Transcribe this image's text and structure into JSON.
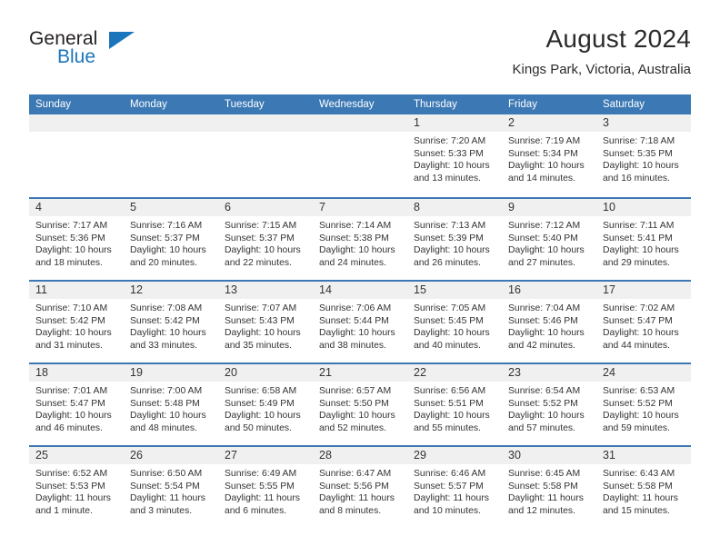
{
  "brand": {
    "name_top": "General",
    "name_bottom": "Blue",
    "triangle_color": "#1b75bb"
  },
  "header": {
    "title": "August 2024",
    "subtitle": "Kings Park, Victoria, Australia",
    "accent_color": "#3b78b4",
    "daynum_band_color": "#f0f0f0"
  },
  "weekdays": [
    "Sunday",
    "Monday",
    "Tuesday",
    "Wednesday",
    "Thursday",
    "Friday",
    "Saturday"
  ],
  "weeks": [
    [
      {
        "day": "",
        "empty": true,
        "sunrise": "",
        "sunset": "",
        "daylight1": "",
        "daylight2": ""
      },
      {
        "day": "",
        "empty": true,
        "sunrise": "",
        "sunset": "",
        "daylight1": "",
        "daylight2": ""
      },
      {
        "day": "",
        "empty": true,
        "sunrise": "",
        "sunset": "",
        "daylight1": "",
        "daylight2": ""
      },
      {
        "day": "",
        "empty": true,
        "sunrise": "",
        "sunset": "",
        "daylight1": "",
        "daylight2": ""
      },
      {
        "day": "1",
        "empty": false,
        "sunrise": "Sunrise: 7:20 AM",
        "sunset": "Sunset: 5:33 PM",
        "daylight1": "Daylight: 10 hours",
        "daylight2": "and 13 minutes."
      },
      {
        "day": "2",
        "empty": false,
        "sunrise": "Sunrise: 7:19 AM",
        "sunset": "Sunset: 5:34 PM",
        "daylight1": "Daylight: 10 hours",
        "daylight2": "and 14 minutes."
      },
      {
        "day": "3",
        "empty": false,
        "sunrise": "Sunrise: 7:18 AM",
        "sunset": "Sunset: 5:35 PM",
        "daylight1": "Daylight: 10 hours",
        "daylight2": "and 16 minutes."
      }
    ],
    [
      {
        "day": "4",
        "empty": false,
        "sunrise": "Sunrise: 7:17 AM",
        "sunset": "Sunset: 5:36 PM",
        "daylight1": "Daylight: 10 hours",
        "daylight2": "and 18 minutes."
      },
      {
        "day": "5",
        "empty": false,
        "sunrise": "Sunrise: 7:16 AM",
        "sunset": "Sunset: 5:37 PM",
        "daylight1": "Daylight: 10 hours",
        "daylight2": "and 20 minutes."
      },
      {
        "day": "6",
        "empty": false,
        "sunrise": "Sunrise: 7:15 AM",
        "sunset": "Sunset: 5:37 PM",
        "daylight1": "Daylight: 10 hours",
        "daylight2": "and 22 minutes."
      },
      {
        "day": "7",
        "empty": false,
        "sunrise": "Sunrise: 7:14 AM",
        "sunset": "Sunset: 5:38 PM",
        "daylight1": "Daylight: 10 hours",
        "daylight2": "and 24 minutes."
      },
      {
        "day": "8",
        "empty": false,
        "sunrise": "Sunrise: 7:13 AM",
        "sunset": "Sunset: 5:39 PM",
        "daylight1": "Daylight: 10 hours",
        "daylight2": "and 26 minutes."
      },
      {
        "day": "9",
        "empty": false,
        "sunrise": "Sunrise: 7:12 AM",
        "sunset": "Sunset: 5:40 PM",
        "daylight1": "Daylight: 10 hours",
        "daylight2": "and 27 minutes."
      },
      {
        "day": "10",
        "empty": false,
        "sunrise": "Sunrise: 7:11 AM",
        "sunset": "Sunset: 5:41 PM",
        "daylight1": "Daylight: 10 hours",
        "daylight2": "and 29 minutes."
      }
    ],
    [
      {
        "day": "11",
        "empty": false,
        "sunrise": "Sunrise: 7:10 AM",
        "sunset": "Sunset: 5:42 PM",
        "daylight1": "Daylight: 10 hours",
        "daylight2": "and 31 minutes."
      },
      {
        "day": "12",
        "empty": false,
        "sunrise": "Sunrise: 7:08 AM",
        "sunset": "Sunset: 5:42 PM",
        "daylight1": "Daylight: 10 hours",
        "daylight2": "and 33 minutes."
      },
      {
        "day": "13",
        "empty": false,
        "sunrise": "Sunrise: 7:07 AM",
        "sunset": "Sunset: 5:43 PM",
        "daylight1": "Daylight: 10 hours",
        "daylight2": "and 35 minutes."
      },
      {
        "day": "14",
        "empty": false,
        "sunrise": "Sunrise: 7:06 AM",
        "sunset": "Sunset: 5:44 PM",
        "daylight1": "Daylight: 10 hours",
        "daylight2": "and 38 minutes."
      },
      {
        "day": "15",
        "empty": false,
        "sunrise": "Sunrise: 7:05 AM",
        "sunset": "Sunset: 5:45 PM",
        "daylight1": "Daylight: 10 hours",
        "daylight2": "and 40 minutes."
      },
      {
        "day": "16",
        "empty": false,
        "sunrise": "Sunrise: 7:04 AM",
        "sunset": "Sunset: 5:46 PM",
        "daylight1": "Daylight: 10 hours",
        "daylight2": "and 42 minutes."
      },
      {
        "day": "17",
        "empty": false,
        "sunrise": "Sunrise: 7:02 AM",
        "sunset": "Sunset: 5:47 PM",
        "daylight1": "Daylight: 10 hours",
        "daylight2": "and 44 minutes."
      }
    ],
    [
      {
        "day": "18",
        "empty": false,
        "sunrise": "Sunrise: 7:01 AM",
        "sunset": "Sunset: 5:47 PM",
        "daylight1": "Daylight: 10 hours",
        "daylight2": "and 46 minutes."
      },
      {
        "day": "19",
        "empty": false,
        "sunrise": "Sunrise: 7:00 AM",
        "sunset": "Sunset: 5:48 PM",
        "daylight1": "Daylight: 10 hours",
        "daylight2": "and 48 minutes."
      },
      {
        "day": "20",
        "empty": false,
        "sunrise": "Sunrise: 6:58 AM",
        "sunset": "Sunset: 5:49 PM",
        "daylight1": "Daylight: 10 hours",
        "daylight2": "and 50 minutes."
      },
      {
        "day": "21",
        "empty": false,
        "sunrise": "Sunrise: 6:57 AM",
        "sunset": "Sunset: 5:50 PM",
        "daylight1": "Daylight: 10 hours",
        "daylight2": "and 52 minutes."
      },
      {
        "day": "22",
        "empty": false,
        "sunrise": "Sunrise: 6:56 AM",
        "sunset": "Sunset: 5:51 PM",
        "daylight1": "Daylight: 10 hours",
        "daylight2": "and 55 minutes."
      },
      {
        "day": "23",
        "empty": false,
        "sunrise": "Sunrise: 6:54 AM",
        "sunset": "Sunset: 5:52 PM",
        "daylight1": "Daylight: 10 hours",
        "daylight2": "and 57 minutes."
      },
      {
        "day": "24",
        "empty": false,
        "sunrise": "Sunrise: 6:53 AM",
        "sunset": "Sunset: 5:52 PM",
        "daylight1": "Daylight: 10 hours",
        "daylight2": "and 59 minutes."
      }
    ],
    [
      {
        "day": "25",
        "empty": false,
        "sunrise": "Sunrise: 6:52 AM",
        "sunset": "Sunset: 5:53 PM",
        "daylight1": "Daylight: 11 hours",
        "daylight2": "and 1 minute."
      },
      {
        "day": "26",
        "empty": false,
        "sunrise": "Sunrise: 6:50 AM",
        "sunset": "Sunset: 5:54 PM",
        "daylight1": "Daylight: 11 hours",
        "daylight2": "and 3 minutes."
      },
      {
        "day": "27",
        "empty": false,
        "sunrise": "Sunrise: 6:49 AM",
        "sunset": "Sunset: 5:55 PM",
        "daylight1": "Daylight: 11 hours",
        "daylight2": "and 6 minutes."
      },
      {
        "day": "28",
        "empty": false,
        "sunrise": "Sunrise: 6:47 AM",
        "sunset": "Sunset: 5:56 PM",
        "daylight1": "Daylight: 11 hours",
        "daylight2": "and 8 minutes."
      },
      {
        "day": "29",
        "empty": false,
        "sunrise": "Sunrise: 6:46 AM",
        "sunset": "Sunset: 5:57 PM",
        "daylight1": "Daylight: 11 hours",
        "daylight2": "and 10 minutes."
      },
      {
        "day": "30",
        "empty": false,
        "sunrise": "Sunrise: 6:45 AM",
        "sunset": "Sunset: 5:58 PM",
        "daylight1": "Daylight: 11 hours",
        "daylight2": "and 12 minutes."
      },
      {
        "day": "31",
        "empty": false,
        "sunrise": "Sunrise: 6:43 AM",
        "sunset": "Sunset: 5:58 PM",
        "daylight1": "Daylight: 11 hours",
        "daylight2": "and 15 minutes."
      }
    ]
  ]
}
